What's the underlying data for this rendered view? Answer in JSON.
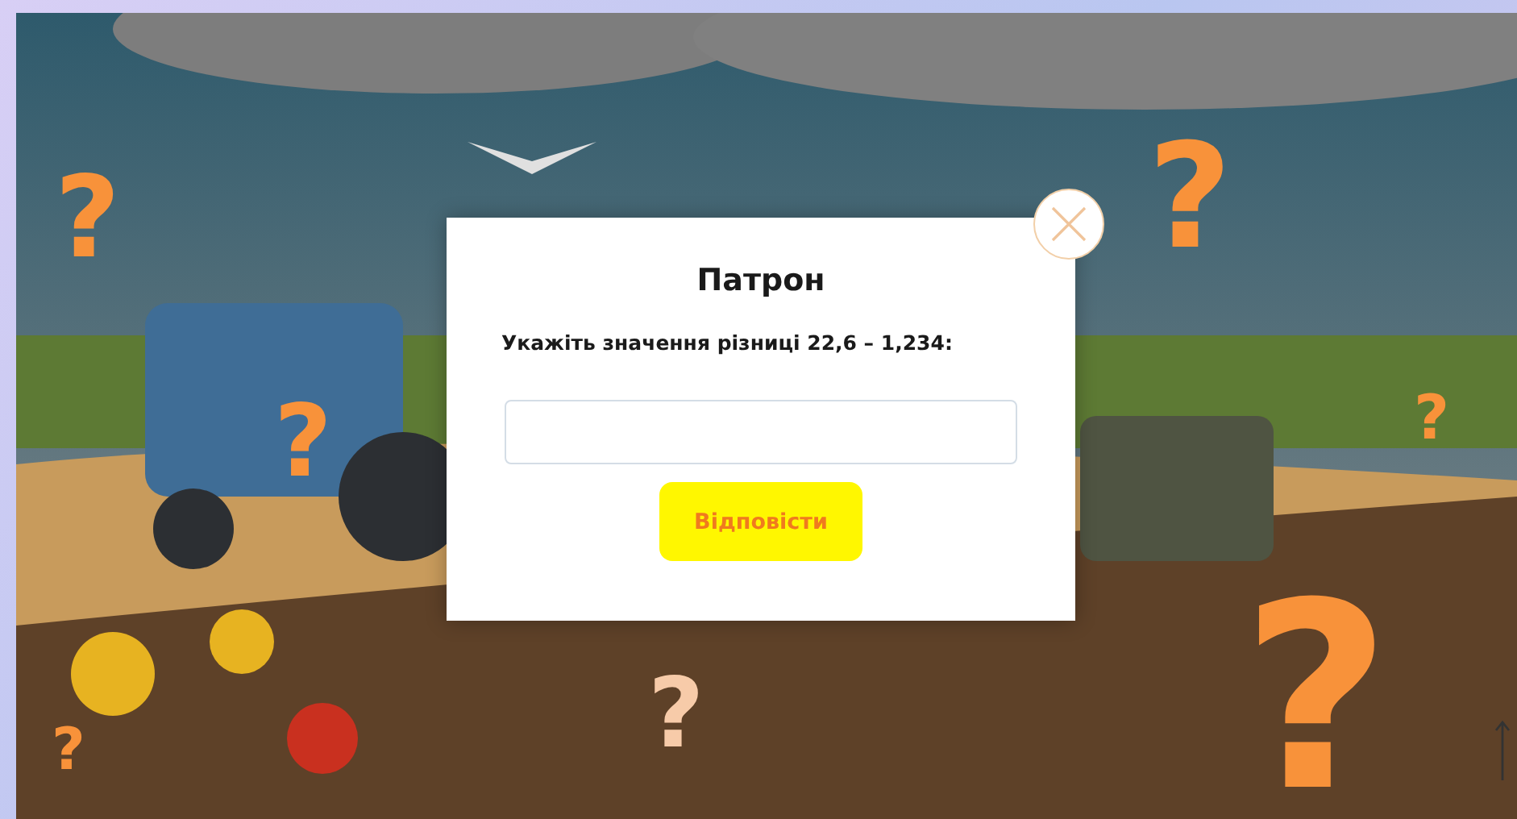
{
  "hotspots": [
    {
      "label": "?",
      "color": "#f8923a"
    },
    {
      "label": "?",
      "color": "#f8923a"
    },
    {
      "label": "?",
      "color": "#f8923a"
    },
    {
      "label": "?",
      "color": "#f8923a"
    },
    {
      "label": "?",
      "color": "#f8923a"
    },
    {
      "label": "?",
      "color": "#f7cba9"
    },
    {
      "label": "?",
      "color": "#f8923a"
    }
  ],
  "dialog": {
    "title": "Патрон",
    "question": "Укажіть значення різниці 22,6 – 1,234:",
    "submit": "Відповісти"
  }
}
